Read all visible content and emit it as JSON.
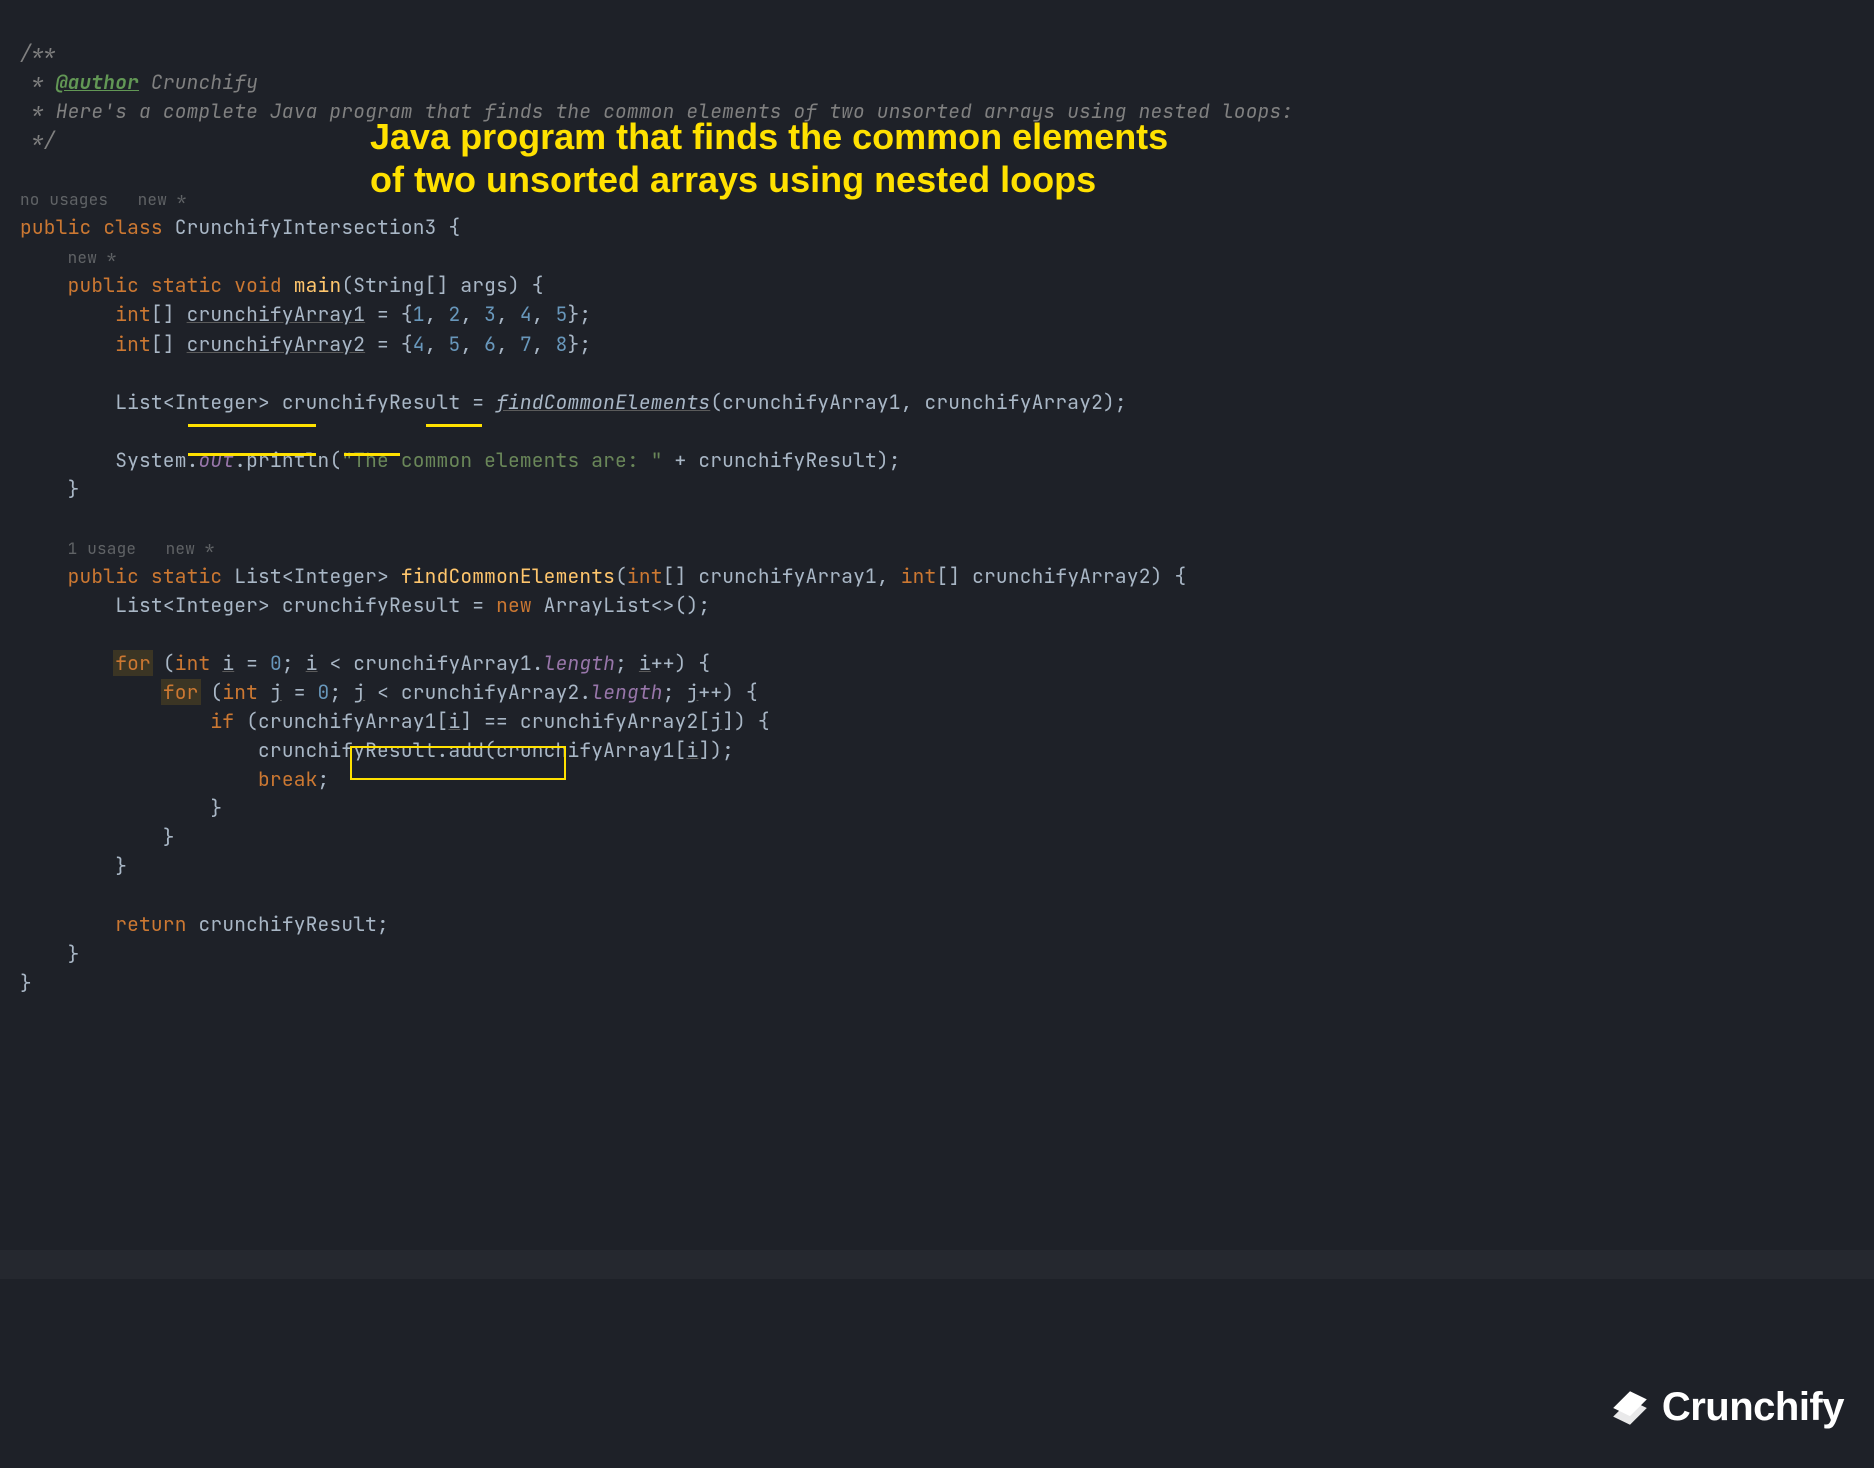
{
  "comment": {
    "open": "/**",
    "author_tag": "@author",
    "author_name": " Crunchify",
    "desc_prefix": " * ",
    "desc": "Here's a complete Java program that finds the common elements of two unsorted arrays using nested loops:",
    "close": " */"
  },
  "inlays": {
    "class_hint": "no usages   new *",
    "main_hint": "new *",
    "method_hint": "1 usage   new *"
  },
  "kw": {
    "public": "public",
    "class": "class",
    "static": "static",
    "void": "void",
    "int_arr": "int",
    "int": "int",
    "new": "new",
    "for": "for",
    "if": "if",
    "break": "break",
    "return": "return"
  },
  "ident": {
    "class_name": "CrunchifyIntersection3",
    "main": "main",
    "String": "String",
    "args": "args",
    "arr1": "crunchifyArray1",
    "arr2": "crunchifyArray2",
    "List": "List",
    "Integer": "Integer",
    "result": "crunchifyResult",
    "findCommon": "findCommonElements",
    "System": "System",
    "out": "out",
    "println": "println",
    "ArrayList": "ArrayList",
    "length": "length",
    "add": "add",
    "i": "i",
    "j": "j"
  },
  "arrays": {
    "a1": [
      1,
      2,
      3,
      4,
      5
    ],
    "a2": [
      4,
      5,
      6,
      7,
      8
    ]
  },
  "strings": {
    "println_msg": "\"The common elements are: \""
  },
  "title_overlay": "Java program that finds the common elements of two unsorted arrays using nested loops",
  "logo_text": "Crunchify"
}
